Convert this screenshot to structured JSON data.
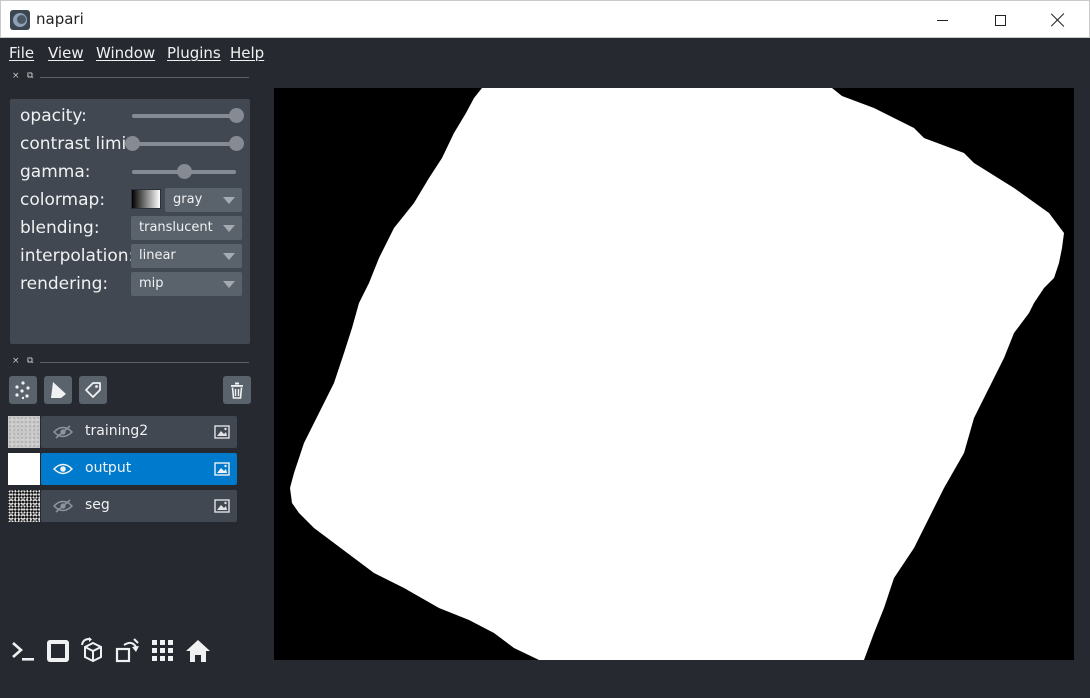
{
  "window": {
    "title": "napari"
  },
  "menu": [
    "File",
    "View",
    "Window",
    "Plugins",
    "Help"
  ],
  "dock": {
    "close_glyph": "×",
    "float_glyph": "⧉"
  },
  "layer_controls": {
    "opacity": {
      "label": "opacity:",
      "value": 1.0
    },
    "contrast": {
      "label": "contrast limits:",
      "low": 0.0,
      "high": 1.0
    },
    "gamma": {
      "label": "gamma:",
      "value": 0.5
    },
    "colormap": {
      "label": "colormap:",
      "value": "gray"
    },
    "blending": {
      "label": "blending:",
      "value": "translucent"
    },
    "interpolation": {
      "label": "interpolation:",
      "value": "linear"
    },
    "rendering": {
      "label": "rendering:",
      "value": "mip"
    }
  },
  "layer_tools": [
    "new-points-icon",
    "new-shapes-icon",
    "new-labels-icon",
    "delete-layer-icon"
  ],
  "layers": [
    {
      "name": "training2",
      "visible": false,
      "selected": false,
      "type": "image"
    },
    {
      "name": "output",
      "visible": true,
      "selected": true,
      "type": "image"
    },
    {
      "name": "seg",
      "visible": false,
      "selected": false,
      "type": "image"
    }
  ],
  "bottom_toolbar": [
    "console-icon",
    "ndisplay-icon",
    "roll-dims-icon",
    "transpose-icon",
    "grid-icon",
    "home-icon"
  ],
  "colors": {
    "selected": "#007acc",
    "panel": "#414851",
    "background": "#262930"
  }
}
